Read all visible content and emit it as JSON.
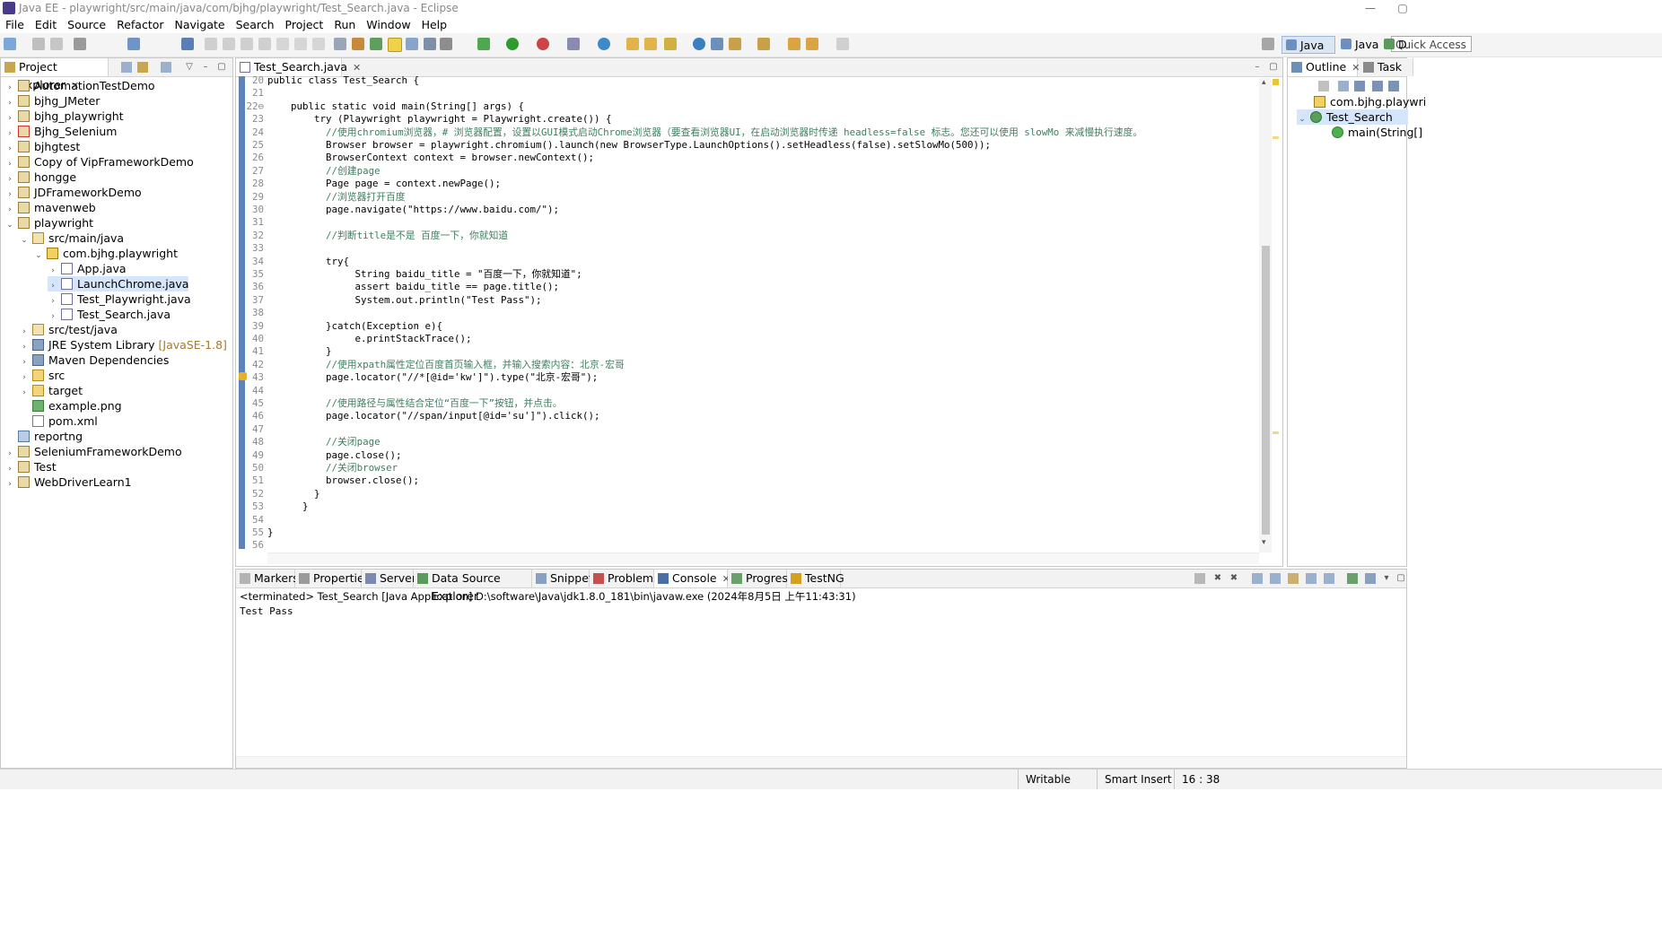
{
  "window": {
    "title": "Java EE - playwright/src/main/java/com/bjhg/playwright/Test_Search.java - Eclipse",
    "minimize_glyph": "—",
    "maximize_glyph": "▢"
  },
  "menu": [
    "File",
    "Edit",
    "Source",
    "Refactor",
    "Navigate",
    "Search",
    "Project",
    "Run",
    "Window",
    "Help"
  ],
  "toolbar": {
    "quick_access": "Quick Access",
    "perspectives": [
      {
        "label": "Java EE",
        "active": true
      },
      {
        "label": "Java",
        "active": false
      },
      {
        "label": "De",
        "active": false
      }
    ]
  },
  "project_explorer": {
    "tab_label": "Project Explorer",
    "close_glyph": "✕",
    "items": [
      {
        "label": "AutomationTestDemo",
        "icon": "project",
        "twisty": "›"
      },
      {
        "label": "bjhg_JMeter",
        "icon": "project",
        "twisty": "›"
      },
      {
        "label": "bjhg_playwright",
        "icon": "project",
        "twisty": "›"
      },
      {
        "label": "Bjhg_Selenium",
        "icon": "project-error",
        "twisty": "›"
      },
      {
        "label": "bjhgtest",
        "icon": "project",
        "twisty": "›"
      },
      {
        "label": "Copy of VipFrameworkDemo",
        "icon": "project",
        "twisty": "›"
      },
      {
        "label": "hongge",
        "icon": "project",
        "twisty": "›"
      },
      {
        "label": "JDFrameworkDemo",
        "icon": "project",
        "twisty": "›"
      },
      {
        "label": "mavenweb",
        "icon": "project",
        "twisty": "›"
      },
      {
        "label": "playwright",
        "icon": "project",
        "twisty": "⌄"
      },
      {
        "label": "src/main/java",
        "icon": "source-folder",
        "twisty": "⌄"
      },
      {
        "label": "com.bjhg.playwright",
        "icon": "package",
        "twisty": "⌄"
      },
      {
        "label": "App.java",
        "icon": "java-file",
        "twisty": "›"
      },
      {
        "label": "LaunchChrome.java",
        "icon": "java-file",
        "twisty": "›"
      },
      {
        "label": "Test_Playwright.java",
        "icon": "java-file",
        "twisty": "›"
      },
      {
        "label": "Test_Search.java",
        "icon": "java-file",
        "twisty": "›"
      },
      {
        "label": "src/test/java",
        "icon": "source-folder",
        "twisty": "›"
      },
      {
        "label": "JRE System Library",
        "icon": "library",
        "twisty": "›",
        "suffix": "[JavaSE-1.8]"
      },
      {
        "label": "Maven Dependencies",
        "icon": "library",
        "twisty": "›"
      },
      {
        "label": "src",
        "icon": "folder",
        "twisty": "›"
      },
      {
        "label": "target",
        "icon": "folder",
        "twisty": "›"
      },
      {
        "label": "example.png",
        "icon": "image-file",
        "twisty": ""
      },
      {
        "label": "pom.xml",
        "icon": "xml-file",
        "twisty": ""
      },
      {
        "label": "reportng",
        "icon": "plain-folder",
        "twisty": ""
      },
      {
        "label": "SeleniumFrameworkDemo",
        "icon": "project",
        "twisty": "›"
      },
      {
        "label": "Test",
        "icon": "project",
        "twisty": "›"
      },
      {
        "label": "WebDriverLearn1",
        "icon": "project",
        "twisty": "›"
      }
    ]
  },
  "editor": {
    "tab_label": "Test_Search.java",
    "close_glyph": "✕",
    "lines": [
      {
        "n": "20",
        "text": "public class Test_Search {"
      },
      {
        "n": "21",
        "text": ""
      },
      {
        "n": "22⊖",
        "text": "    public static void main(String[] args) {"
      },
      {
        "n": "23",
        "text": "        try (Playwright playwright = Playwright.create()) {"
      },
      {
        "n": "24",
        "text": "          //使用chromium浏览器，# 浏览器配置，设置以GUI模式启动Chrome浏览器（要查看浏览器UI，在启动浏览器时传递 headless=false 标志。您还可以使用 slowMo 来减慢执行速度。"
      },
      {
        "n": "25",
        "text": "          Browser browser = playwright.chromium().launch(new BrowserType.LaunchOptions().setHeadless(false).setSlowMo(500));"
      },
      {
        "n": "26",
        "text": "          BrowserContext context = browser.newContext();"
      },
      {
        "n": "27",
        "text": "          //创建page"
      },
      {
        "n": "28",
        "text": "          Page page = context.newPage();"
      },
      {
        "n": "29",
        "text": "          //浏览器打开百度"
      },
      {
        "n": "30",
        "text": "          page.navigate(\"https://www.baidu.com/\");"
      },
      {
        "n": "31",
        "text": ""
      },
      {
        "n": "32",
        "text": "          //判断title是不是 百度一下，你就知道"
      },
      {
        "n": "33",
        "text": ""
      },
      {
        "n": "34",
        "text": "          try{"
      },
      {
        "n": "35",
        "text": "               String baidu_title = \"百度一下，你就知道\";"
      },
      {
        "n": "36",
        "text": "               assert baidu_title == page.title();"
      },
      {
        "n": "37",
        "text": "               System.out.println(\"Test Pass\");"
      },
      {
        "n": "38",
        "text": ""
      },
      {
        "n": "39",
        "text": "          }catch(Exception e){"
      },
      {
        "n": "40",
        "text": "               e.printStackTrace();"
      },
      {
        "n": "41",
        "text": "          }"
      },
      {
        "n": "42",
        "text": "          //使用xpath属性定位百度首页输入框，并输入搜索内容：北京-宏哥"
      },
      {
        "n": "43",
        "text": "          page.locator(\"//*[@id='kw']\").type(\"北京-宏哥\");"
      },
      {
        "n": "44",
        "text": ""
      },
      {
        "n": "45",
        "text": "          //使用路径与属性结合定位“百度一下”按钮，并点击。"
      },
      {
        "n": "46",
        "text": "          page.locator(\"//span/input[@id='su']\").click();"
      },
      {
        "n": "47",
        "text": ""
      },
      {
        "n": "48",
        "text": "          //关闭page"
      },
      {
        "n": "49",
        "text": "          page.close();"
      },
      {
        "n": "50",
        "text": "          //关闭browser"
      },
      {
        "n": "51",
        "text": "          browser.close();"
      },
      {
        "n": "52",
        "text": "        }"
      },
      {
        "n": "53",
        "text": "      }"
      },
      {
        "n": "54",
        "text": ""
      },
      {
        "n": "55",
        "text": "}"
      },
      {
        "n": "56",
        "text": ""
      }
    ]
  },
  "outline": {
    "tab_label": "Outline",
    "tab2_label": "Task Li",
    "items": [
      {
        "label": "com.bjhg.playwri",
        "icon": "package"
      },
      {
        "label": "Test_Search",
        "icon": "class"
      },
      {
        "label": "main(String[]",
        "icon": "method"
      }
    ]
  },
  "bottom_tabs": [
    "Markers",
    "Properties",
    "Servers",
    "Data Source Explorer",
    "Snippets",
    "Problems",
    "Console",
    "Progress",
    "TestNG"
  ],
  "console": {
    "header": "<terminated> Test_Search [Java Application] D:\\software\\Java\\jdk1.8.0_181\\bin\\javaw.exe (2024年8月5日 上午11:43:31)",
    "output": "Test Pass"
  },
  "statusbar": {
    "writable": "Writable",
    "insert_mode": "Smart Insert",
    "position": "16 : 38"
  },
  "colors": {
    "keyword": "#7f0055",
    "comment": "#3f7f5f",
    "string": "#2a00ff",
    "selection": "#d6e6fa",
    "gutter_bar": "#5d83b8"
  }
}
